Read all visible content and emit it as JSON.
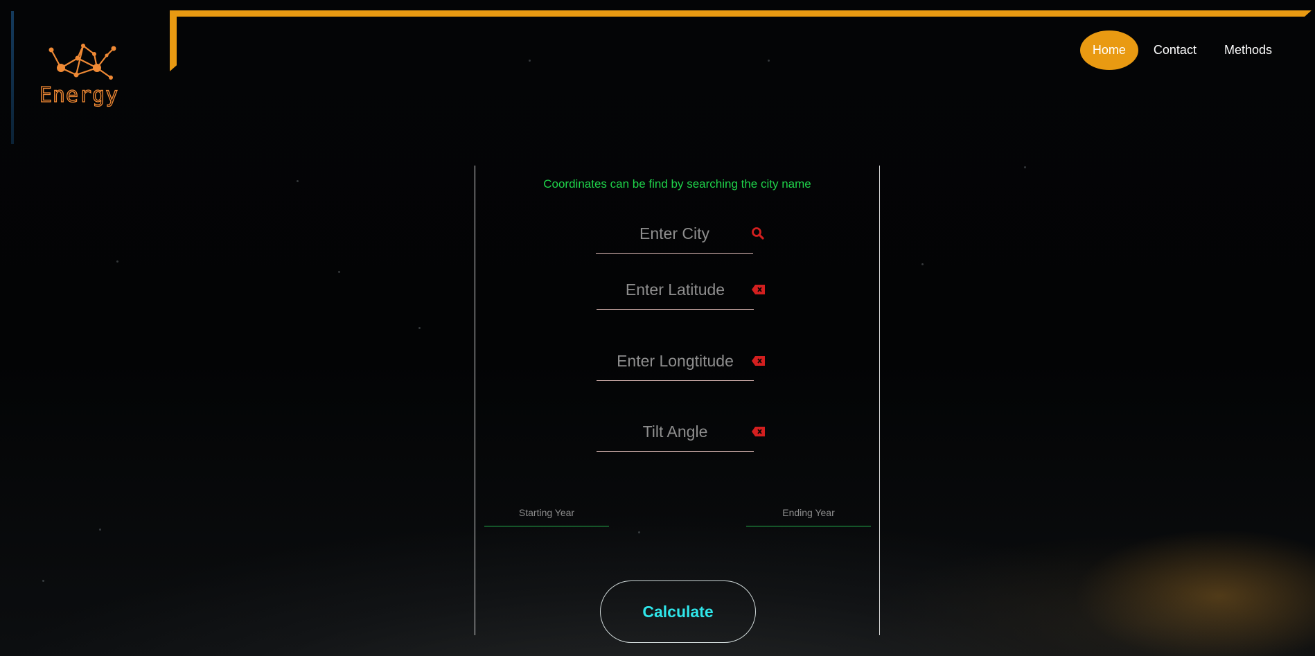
{
  "brand": {
    "name": "Energy",
    "logo_icon": "network-nodes-icon",
    "accent": "#e99a12",
    "logo_color": "#f08a35"
  },
  "nav": {
    "items": [
      {
        "label": "Home",
        "active": true
      },
      {
        "label": "Contact",
        "active": false
      },
      {
        "label": "Methods",
        "active": false
      }
    ]
  },
  "form": {
    "hint": "Coordinates can be find by searching the city name",
    "hint_color": "#1fd24a",
    "city": {
      "placeholder": "Enter City",
      "value": "",
      "icon": "search-icon"
    },
    "latitude": {
      "placeholder": "Enter Latitude",
      "value": "",
      "icon": "clear-backspace-icon"
    },
    "longitude": {
      "placeholder": "Enter Longtitude",
      "value": "",
      "icon": "clear-backspace-icon"
    },
    "tilt": {
      "placeholder": "Tilt Angle",
      "value": "",
      "icon": "clear-backspace-icon"
    },
    "start_year": {
      "placeholder": "Starting Year",
      "value": ""
    },
    "end_year": {
      "placeholder": "Ending Year",
      "value": ""
    },
    "submit_label": "Calculate",
    "submit_color": "#2fe6ea",
    "icon_color": "#d31f1f"
  }
}
